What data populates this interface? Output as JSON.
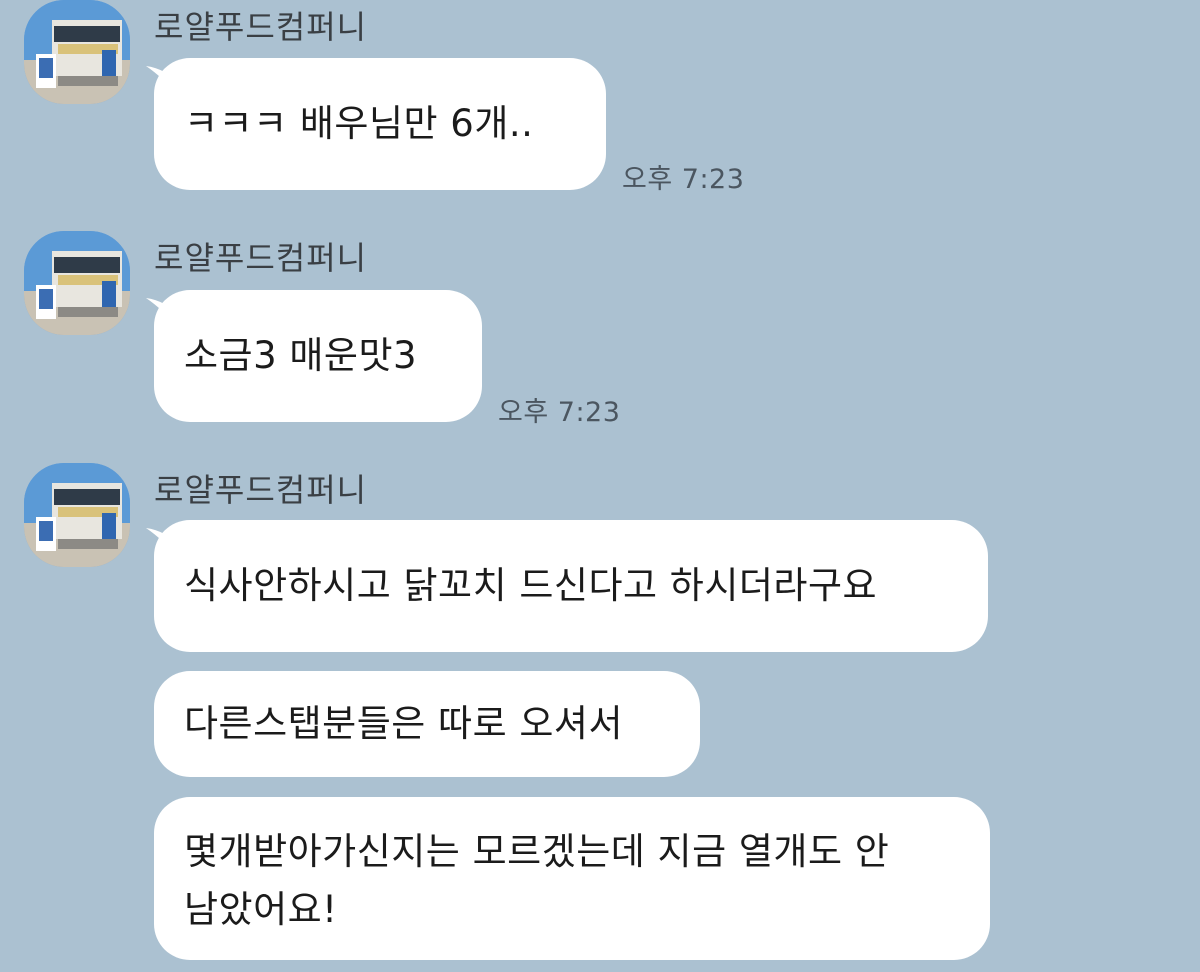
{
  "chat": {
    "groups": [
      {
        "sender": "로얄푸드컴퍼니",
        "messages": [
          {
            "text": "ㅋㅋㅋ 배우님만 6개..",
            "time": "오후 7:23"
          }
        ]
      },
      {
        "sender": "로얄푸드컴퍼니",
        "messages": [
          {
            "text": "소금3 매운맛3",
            "time": "오후 7:23"
          }
        ]
      },
      {
        "sender": "로얄푸드컴퍼니",
        "messages": [
          {
            "text": "식사안하시고 닭꼬치 드신다고 하시더라구요"
          },
          {
            "text": "다른스탭분들은 따로 오셔서"
          },
          {
            "line1": "몇개받아가신지는 모르겠는데 지금 열개도 안",
            "line2": "남았어요!"
          }
        ]
      }
    ]
  },
  "colors": {
    "background": "#abc1d1",
    "bubble": "#ffffff",
    "timestamp": "#4b5660"
  },
  "icons": {
    "avatar": "food-truck-photo"
  }
}
